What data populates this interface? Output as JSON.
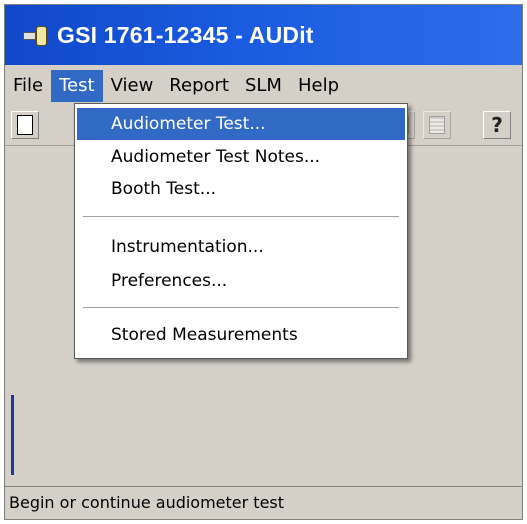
{
  "window": {
    "title": "GSI 1761-12345 - AUDit"
  },
  "menubar": {
    "items": [
      {
        "label": "File"
      },
      {
        "label": "Test"
      },
      {
        "label": "View"
      },
      {
        "label": "Report"
      },
      {
        "label": "SLM"
      },
      {
        "label": "Help"
      }
    ],
    "active": "Test"
  },
  "toolbar": {
    "help_glyph": "?"
  },
  "test_menu": {
    "items": [
      {
        "label": "Audiometer Test..."
      },
      {
        "label": "Audiometer Test Notes..."
      },
      {
        "label": "Booth Test..."
      },
      {
        "label": "Instrumentation..."
      },
      {
        "label": "Preferences..."
      },
      {
        "label": "Stored Measurements"
      }
    ],
    "highlighted": "Audiometer Test..."
  },
  "statusbar": {
    "text": "Begin or continue audiometer test"
  },
  "colors": {
    "title_bar": "#1a5be0",
    "highlight": "#316ac5",
    "window_bg": "#d4d0c8"
  }
}
